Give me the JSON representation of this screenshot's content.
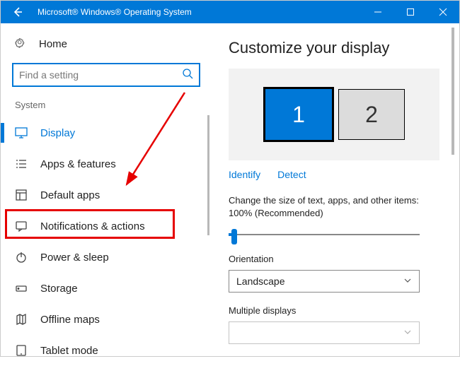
{
  "titlebar": {
    "title": "Microsoft® Windows® Operating System"
  },
  "sidebar": {
    "home": "Home",
    "search_placeholder": "Find a setting",
    "section": "System",
    "items": [
      {
        "label": "Display",
        "icon": "display"
      },
      {
        "label": "Apps & features",
        "icon": "list"
      },
      {
        "label": "Default apps",
        "icon": "defaults"
      },
      {
        "label": "Notifications & actions",
        "icon": "chat"
      },
      {
        "label": "Power & sleep",
        "icon": "power"
      },
      {
        "label": "Storage",
        "icon": "storage"
      },
      {
        "label": "Offline maps",
        "icon": "map"
      },
      {
        "label": "Tablet mode",
        "icon": "tablet"
      }
    ]
  },
  "main": {
    "heading": "Customize your display",
    "monitors": [
      "1",
      "2"
    ],
    "identify": "Identify",
    "detect": "Detect",
    "scale_text": "Change the size of text, apps, and other items: 100% (Recommended)",
    "orientation_label": "Orientation",
    "orientation_value": "Landscape",
    "multiple_label": "Multiple displays"
  }
}
